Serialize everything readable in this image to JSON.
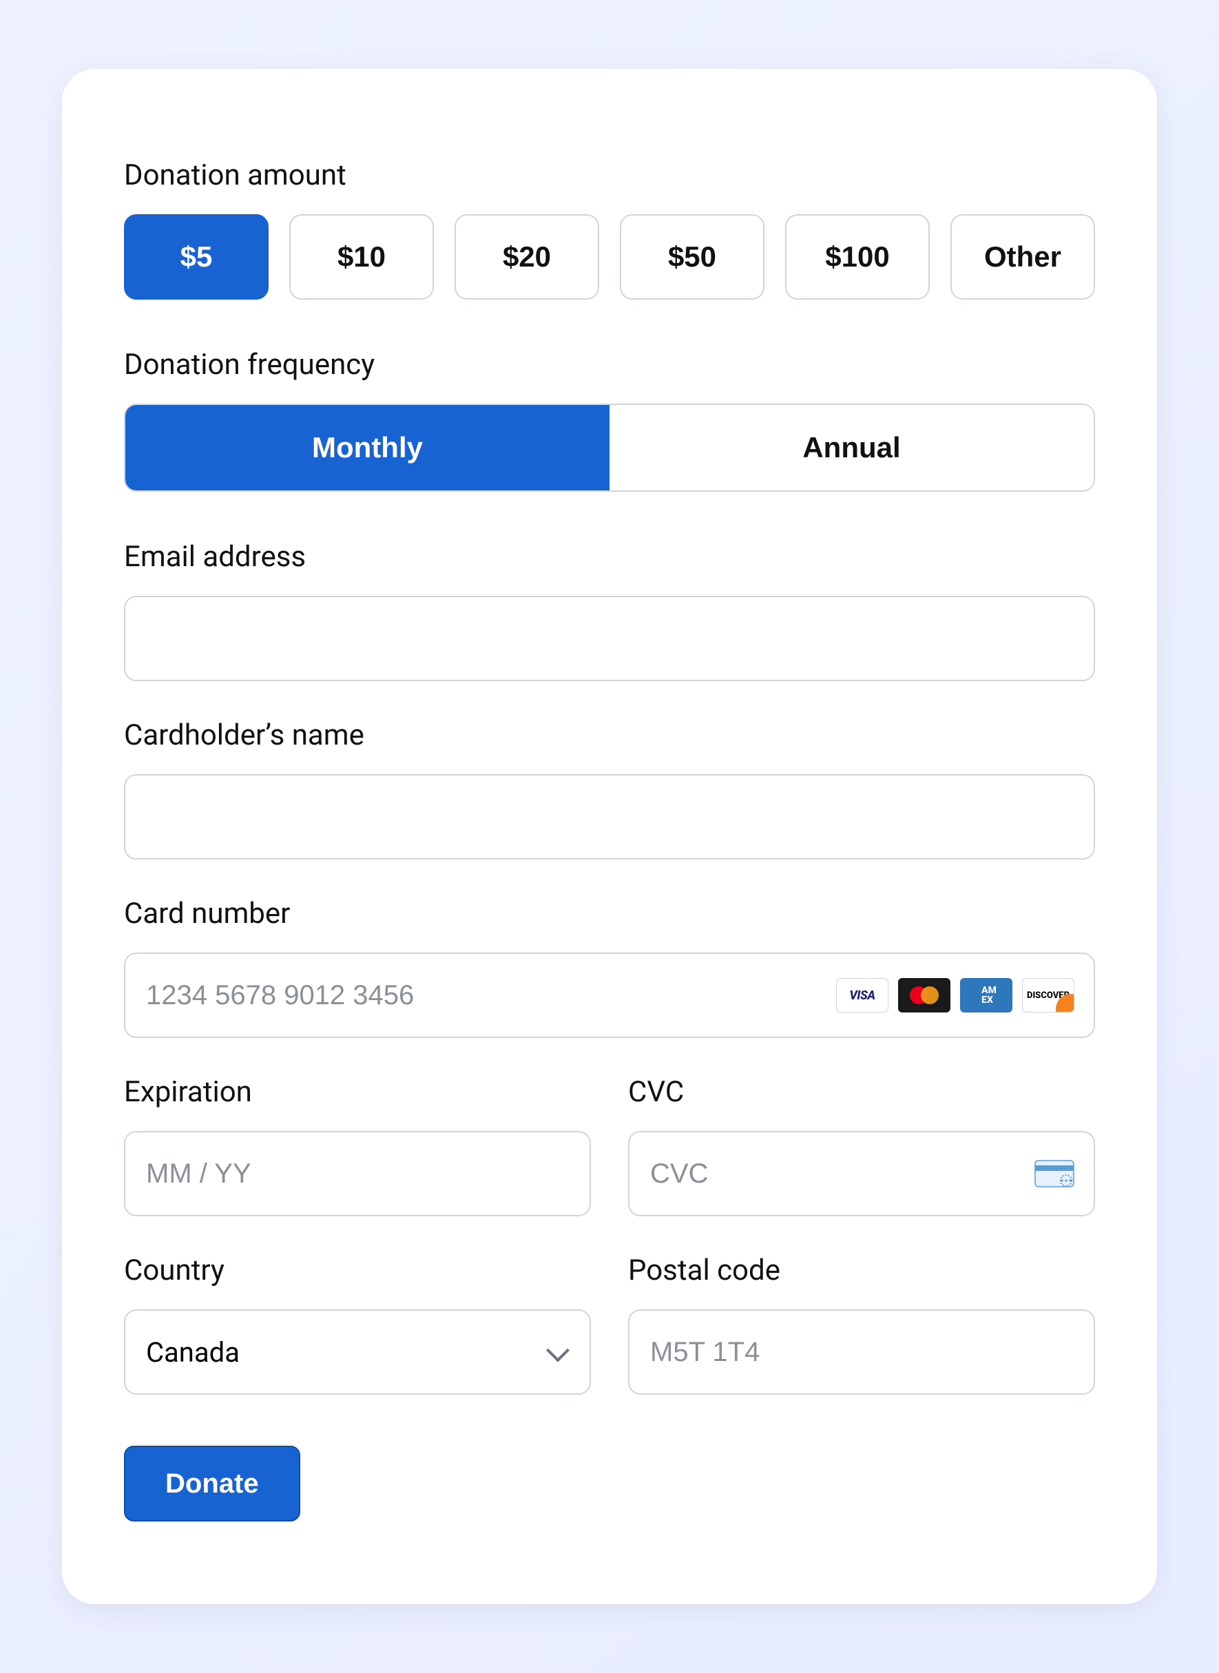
{
  "donation": {
    "amount_label": "Donation amount",
    "amounts": [
      "$5",
      "$10",
      "$20",
      "$50",
      "$100",
      "Other"
    ],
    "selected_amount_index": 0,
    "frequency_label": "Donation frequency",
    "frequencies": [
      "Monthly",
      "Annual"
    ],
    "selected_frequency_index": 0
  },
  "email": {
    "label": "Email address",
    "value": "",
    "placeholder": ""
  },
  "cardholder": {
    "label": "Cardholder’s name",
    "value": "",
    "placeholder": ""
  },
  "card_number": {
    "label": "Card number",
    "value": "",
    "placeholder": "1234 5678 9012 3456",
    "brands": [
      "visa",
      "mastercard",
      "amex",
      "discover"
    ]
  },
  "expiration": {
    "label": "Expiration",
    "value": "",
    "placeholder": "MM / YY"
  },
  "cvc": {
    "label": "CVC",
    "value": "",
    "placeholder": "CVC"
  },
  "country": {
    "label": "Country",
    "value": "Canada"
  },
  "postal": {
    "label": "Postal code",
    "value": "",
    "placeholder": "M5T 1T4"
  },
  "submit": {
    "label": "Donate"
  },
  "colors": {
    "primary": "#1763d2",
    "border": "#d1d5db"
  }
}
